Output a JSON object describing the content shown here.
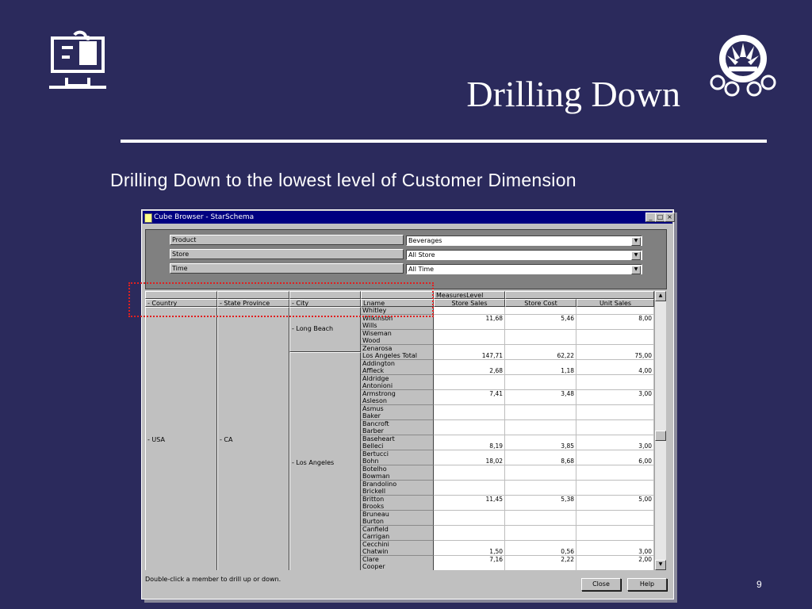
{
  "slide": {
    "title": "Drilling Down",
    "subtitle": "Drilling Down to the lowest level of Customer Dimension",
    "page_number": "9"
  },
  "window": {
    "title": "Cube Browser - StarSchema",
    "filters": [
      {
        "label": "Product",
        "value": "Beverages"
      },
      {
        "label": "Store",
        "value": "All Store"
      },
      {
        "label": "Time",
        "value": "All Time"
      }
    ],
    "measures_level": "MeasuresLevel",
    "dimension_headers": [
      "- Country",
      "- State Province",
      "- City",
      "Lname"
    ],
    "measure_headers": [
      "Store Sales",
      "Store Cost",
      "Unit Sales"
    ],
    "country": "- USA",
    "state": "- CA",
    "cities": [
      "- Long Beach",
      "- Los Angeles"
    ],
    "rows": [
      {
        "name": "Whitley",
        "sales": "",
        "cost": "",
        "units": ""
      },
      {
        "name": "Wilkinson",
        "sales": "11,68",
        "cost": "5,46",
        "units": "8,00"
      },
      {
        "name": "Wills",
        "sales": "",
        "cost": "",
        "units": ""
      },
      {
        "name": "Wiseman",
        "sales": "",
        "cost": "",
        "units": ""
      },
      {
        "name": "Wood",
        "sales": "",
        "cost": "",
        "units": ""
      },
      {
        "name": "Zenarosa",
        "sales": "",
        "cost": "",
        "units": ""
      },
      {
        "name": "Los Angeles Total",
        "sales": "147,71",
        "cost": "62,22",
        "units": "75,00"
      },
      {
        "name": "Addington",
        "sales": "",
        "cost": "",
        "units": ""
      },
      {
        "name": "Affleck",
        "sales": "2,68",
        "cost": "1,18",
        "units": "4,00"
      },
      {
        "name": "Aldridge",
        "sales": "",
        "cost": "",
        "units": ""
      },
      {
        "name": "Antonioni",
        "sales": "",
        "cost": "",
        "units": ""
      },
      {
        "name": "Armstrong",
        "sales": "7,41",
        "cost": "3,48",
        "units": "3,00"
      },
      {
        "name": "Asleson",
        "sales": "",
        "cost": "",
        "units": ""
      },
      {
        "name": "Asmus",
        "sales": "",
        "cost": "",
        "units": ""
      },
      {
        "name": "Baker",
        "sales": "",
        "cost": "",
        "units": ""
      },
      {
        "name": "Bancroft",
        "sales": "",
        "cost": "",
        "units": ""
      },
      {
        "name": "Barber",
        "sales": "",
        "cost": "",
        "units": ""
      },
      {
        "name": "Baseheart",
        "sales": "",
        "cost": "",
        "units": ""
      },
      {
        "name": "Belleci",
        "sales": "8,19",
        "cost": "3,85",
        "units": "3,00"
      },
      {
        "name": "Bertucci",
        "sales": "",
        "cost": "",
        "units": ""
      },
      {
        "name": "Bohn",
        "sales": "18,02",
        "cost": "8,68",
        "units": "6,00"
      },
      {
        "name": "Botelho",
        "sales": "",
        "cost": "",
        "units": ""
      },
      {
        "name": "Bowman",
        "sales": "",
        "cost": "",
        "units": ""
      },
      {
        "name": "Brandolino",
        "sales": "",
        "cost": "",
        "units": ""
      },
      {
        "name": "Brickell",
        "sales": "",
        "cost": "",
        "units": ""
      },
      {
        "name": "Britton",
        "sales": "11,45",
        "cost": "5,38",
        "units": "5,00"
      },
      {
        "name": "Brooks",
        "sales": "",
        "cost": "",
        "units": ""
      },
      {
        "name": "Bruneau",
        "sales": "",
        "cost": "",
        "units": ""
      },
      {
        "name": "Burton",
        "sales": "",
        "cost": "",
        "units": ""
      },
      {
        "name": "Canfield",
        "sales": "",
        "cost": "",
        "units": ""
      },
      {
        "name": "Carrigan",
        "sales": "",
        "cost": "",
        "units": ""
      },
      {
        "name": "Cecchini",
        "sales": "",
        "cost": "",
        "units": ""
      },
      {
        "name": "Chatwin",
        "sales": "1,50",
        "cost": "0,56",
        "units": "3,00"
      },
      {
        "name": "Clare",
        "sales": "7,16",
        "cost": "2,22",
        "units": "2,00"
      },
      {
        "name": "Cooper",
        "sales": "",
        "cost": "",
        "units": ""
      }
    ],
    "status_text": "Double-click a member to drill up or down.",
    "close_label": "Close",
    "help_label": "Help"
  }
}
